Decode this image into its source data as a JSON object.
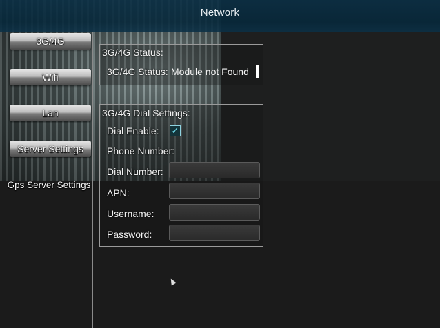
{
  "window": {
    "title": "Network"
  },
  "sidebar": {
    "items": [
      {
        "label": "3G/4G"
      },
      {
        "label": "Wifi"
      },
      {
        "label": "Lan"
      },
      {
        "label": "Server Settings"
      },
      {
        "label": "Gps Server Settings"
      }
    ]
  },
  "status_group": {
    "title": "3G/4G Status:",
    "status_label": "3G/4G Status:",
    "status_value": "Module not Found"
  },
  "dial_group": {
    "title": "3G/4G Dial Settings:",
    "dial_enable_label": "Dial Enable:",
    "dial_enable_checked": true,
    "phone_number_label": "Phone Number:",
    "phone_number_value": "",
    "dial_number_label": "Dial Number:",
    "dial_number_value": "",
    "apn_label": "APN:",
    "apn_value": "",
    "username_label": "Username:",
    "username_value": "",
    "password_label": "Password:",
    "password_value": ""
  },
  "icons": {
    "checkbox_check": "check-icon",
    "pointer": "mouse-cursor-icon"
  },
  "colors": {
    "titlebar": "#06283b",
    "check": "#6fe0f0"
  }
}
